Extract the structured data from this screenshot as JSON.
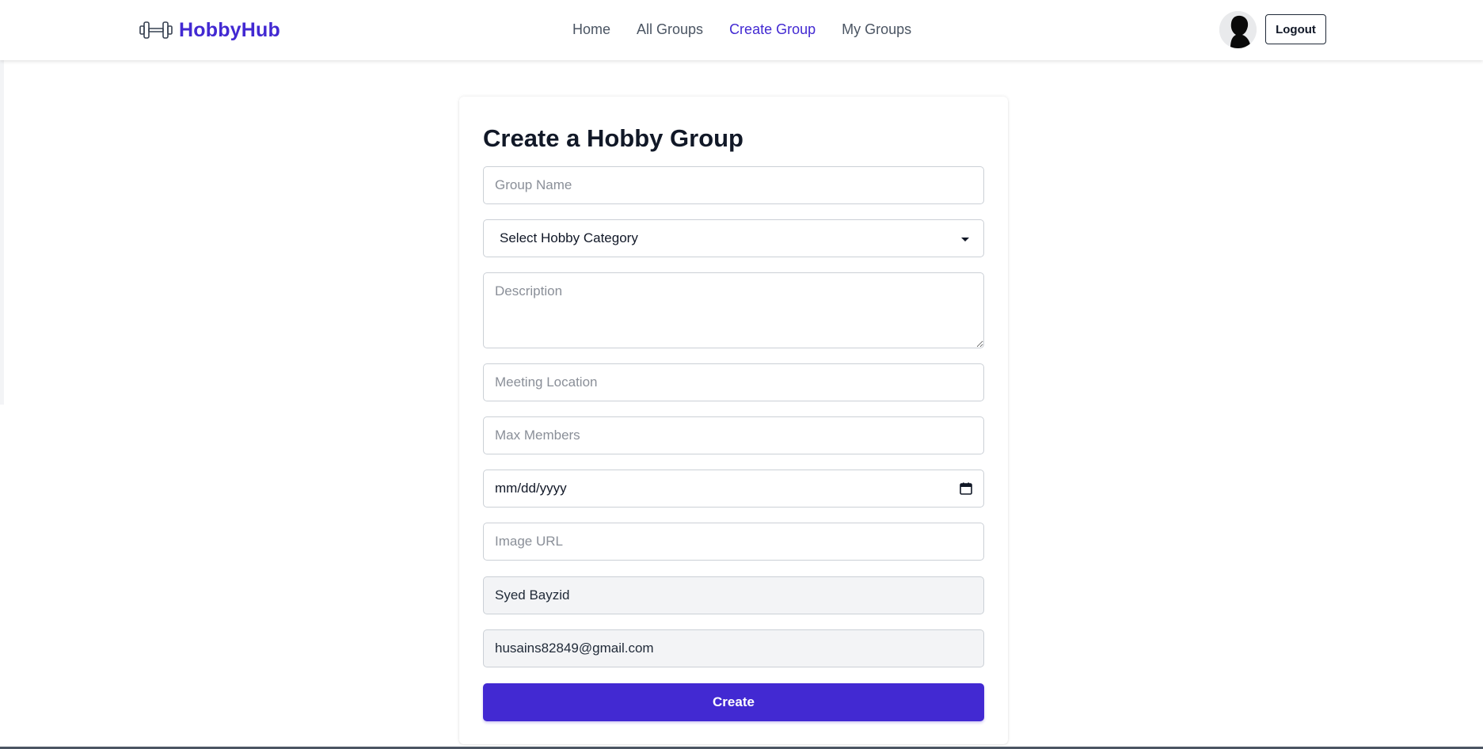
{
  "navbar": {
    "brand": "HobbyHub",
    "brand_icon": "dumbbell-icon",
    "links": [
      {
        "label": "Home",
        "active": false
      },
      {
        "label": "All Groups",
        "active": false
      },
      {
        "label": "Create Group",
        "active": true
      },
      {
        "label": "My Groups",
        "active": false
      }
    ],
    "logout_label": "Logout"
  },
  "form": {
    "title": "Create a Hobby Group",
    "group_name_placeholder": "Group Name",
    "category_selected": "Select Hobby Category",
    "description_placeholder": "Description",
    "location_placeholder": "Meeting Location",
    "max_members_placeholder": "Max Members",
    "date_placeholder": "mm/dd/yyyy",
    "image_url_placeholder": "Image URL",
    "user_name": "Syed Bayzid",
    "user_email": "husains82849@gmail.com",
    "submit_label": "Create"
  },
  "colors": {
    "brand": "#4229d2",
    "readonly_bg": "#f3f4f6"
  }
}
